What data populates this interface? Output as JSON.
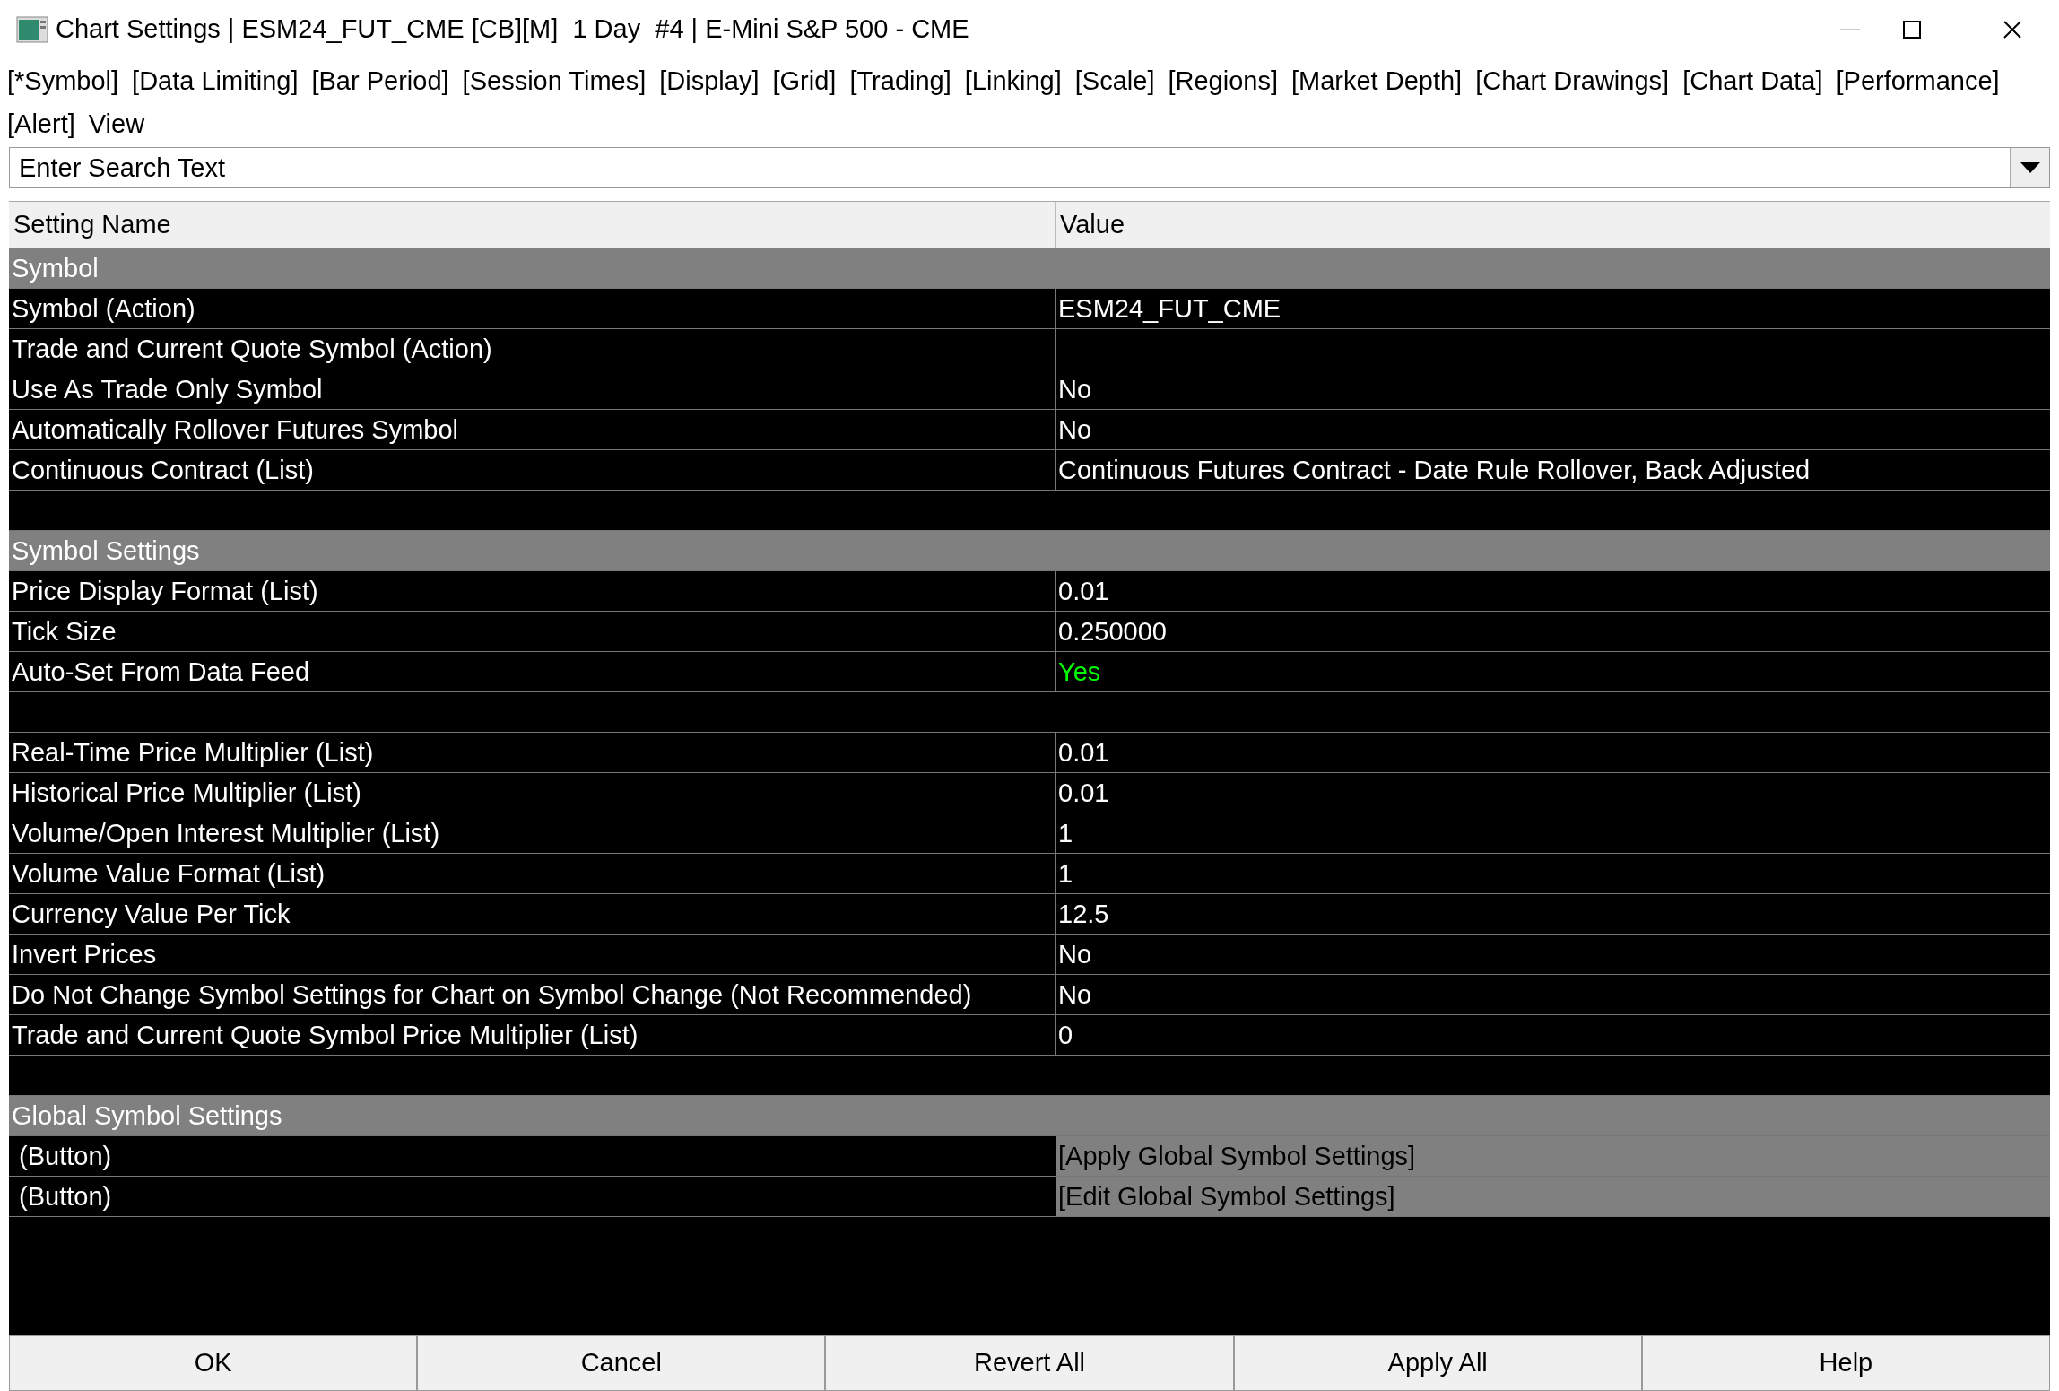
{
  "window": {
    "title": "Chart Settings | ESM24_FUT_CME [CB][M]  1 Day  #4 | E-Mini S&P 500 - CME"
  },
  "tabs": [
    "[*Symbol]",
    "[Data Limiting]",
    "[Bar Period]",
    "[Session Times]",
    "[Display]",
    "[Grid]",
    "[Trading]",
    "[Linking]",
    "[Scale]",
    "[Regions]",
    "[Market Depth]",
    "[Chart Drawings]",
    "[Chart Data]",
    "[Performance]",
    "[Alert]",
    "View"
  ],
  "search": {
    "placeholder": "Enter Search Text"
  },
  "table": {
    "columns": [
      "Setting Name",
      "Value"
    ],
    "rows": [
      {
        "kind": "section",
        "name": "Symbol"
      },
      {
        "kind": "setting",
        "name": "Symbol (Action)",
        "value": "ESM24_FUT_CME"
      },
      {
        "kind": "setting",
        "name": "Trade and Current Quote Symbol (Action)"
      },
      {
        "kind": "setting",
        "name": "Use As Trade Only Symbol",
        "value": "No"
      },
      {
        "kind": "setting",
        "name": "Automatically Rollover Futures Symbol",
        "value": "No"
      },
      {
        "kind": "setting",
        "name": "Continuous Contract (List)",
        "value": "Continuous Futures Contract - Date Rule Rollover, Back Adjusted"
      },
      {
        "kind": "blank"
      },
      {
        "kind": "section",
        "name": "Symbol Settings"
      },
      {
        "kind": "setting",
        "name": "Price Display Format (List)",
        "value": "0.01"
      },
      {
        "kind": "setting",
        "name": "Tick Size",
        "value": "0.250000"
      },
      {
        "kind": "setting",
        "name": "Auto-Set From Data Feed",
        "value": "Yes",
        "color": "#00ff00"
      },
      {
        "kind": "blank"
      },
      {
        "kind": "setting",
        "name": "Real-Time Price Multiplier (List)",
        "value": "0.01"
      },
      {
        "kind": "setting",
        "name": "Historical Price Multiplier (List)",
        "value": "0.01"
      },
      {
        "kind": "setting",
        "name": "Volume/Open Interest Multiplier (List)",
        "value": "1"
      },
      {
        "kind": "setting",
        "name": "Volume Value Format (List)",
        "value": "1"
      },
      {
        "kind": "setting",
        "name": "Currency Value Per Tick",
        "value": "12.5"
      },
      {
        "kind": "setting",
        "name": "Invert Prices",
        "value": "No"
      },
      {
        "kind": "setting",
        "name": "Do Not Change Symbol Settings for Chart on Symbol Change (Not Recommended)",
        "value": "No"
      },
      {
        "kind": "setting",
        "name": "Trade and Current Quote Symbol Price Multiplier (List)",
        "value": "0"
      },
      {
        "kind": "blank"
      },
      {
        "kind": "section",
        "name": "Global Symbol Settings"
      },
      {
        "kind": "button",
        "name": " (Button)",
        "value": "[Apply Global Symbol Settings]"
      },
      {
        "kind": "button",
        "name": " (Button)",
        "value": "[Edit Global Symbol Settings]"
      }
    ]
  },
  "buttons": [
    "OK",
    "Cancel",
    "Revert All",
    "Apply All",
    "Help"
  ]
}
